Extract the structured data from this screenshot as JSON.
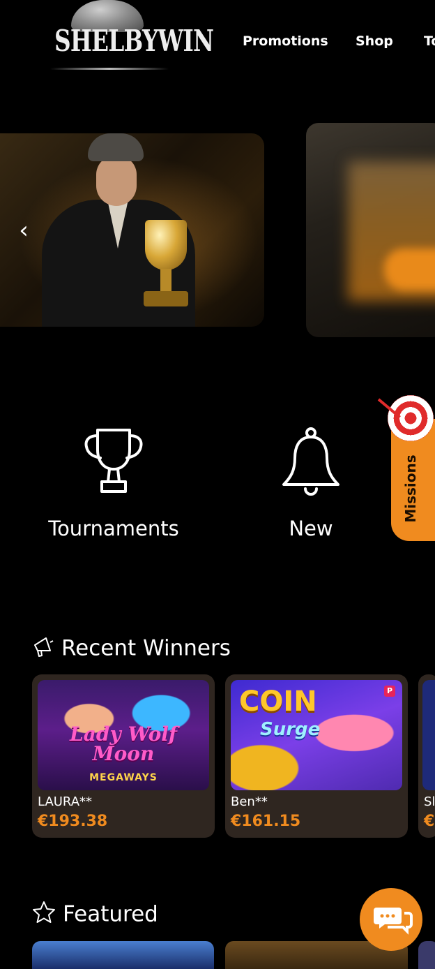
{
  "header": {
    "logo_text": "SHELBYWIN",
    "nav": [
      "Promotions",
      "Shop",
      "To"
    ]
  },
  "carousel": {
    "prev_icon": "chevron-left-icon"
  },
  "categories": [
    {
      "label": "Tournaments",
      "icon": "trophy-icon"
    },
    {
      "label": "New",
      "icon": "bell-icon"
    }
  ],
  "missions": {
    "label": "Missions",
    "icon": "target-icon"
  },
  "recent_winners": {
    "title": "Recent Winners",
    "icon": "megaphone-icon",
    "items": [
      {
        "game_title": "Lady Wolf Moon",
        "game_sub": "MEGAWAYS",
        "name": "LAURA**",
        "amount": "€193.38"
      },
      {
        "game_title": "COIN",
        "game_sub": "Surge",
        "badge": "P",
        "name": "Ben**",
        "amount": "€161.15"
      },
      {
        "name": "Sl",
        "amount": "€"
      }
    ]
  },
  "featured": {
    "title": "Featured",
    "icon": "star-icon"
  },
  "chat": {
    "icon": "chat-icon"
  },
  "colors": {
    "accent": "#f08b1f",
    "card_bg": "#2f2620",
    "background": "#000000"
  }
}
